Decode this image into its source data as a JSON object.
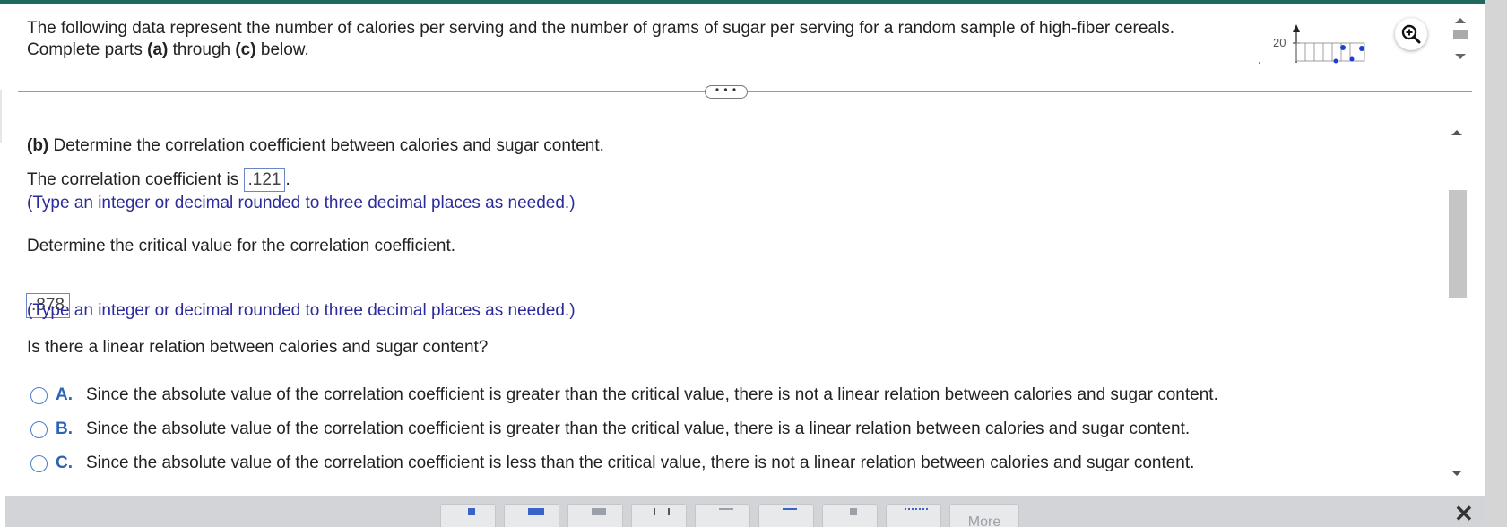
{
  "intro": {
    "line1": "The following data represent the number of calories per serving and the number of grams of sugar per serving for a random sample of high-fiber cereals.",
    "line2_pre": "Complete parts ",
    "line2_a": "(a)",
    "line2_mid": " through ",
    "line2_c": "(c)",
    "line2_post": " below."
  },
  "thumbnail": {
    "axis_label": "20"
  },
  "expander_label": "• • •",
  "part_b": {
    "label": "(b)",
    "heading": " Determine the correlation coefficient between calories and sugar content.",
    "corr_prefix": "The correlation coefficient is ",
    "corr_value": ".121",
    "corr_suffix": ".",
    "hint1": "(Type an integer or decimal rounded to three decimal places as needed.)",
    "critical_prompt": "Determine the critical value for the correlation coefficient.",
    "critical_value": ".878",
    "hint2": "(Type an integer or decimal rounded to three decimal places as needed.)",
    "linear_question": "Is there a linear relation between calories and sugar content?"
  },
  "options": [
    {
      "letter": "A.",
      "text": "Since the absolute value of the correlation coefficient is greater than the critical value, there is not a linear relation between calories and sugar content."
    },
    {
      "letter": "B.",
      "text": "Since the absolute value of the correlation coefficient is greater than the critical value, there is a linear relation between calories and sugar content."
    },
    {
      "letter": "C.",
      "text": "Since the absolute value of the correlation coefficient is less than the critical value, there is not a linear relation between calories and sugar content."
    }
  ],
  "palette": {
    "more_label": "More"
  },
  "close_glyph": "✕"
}
